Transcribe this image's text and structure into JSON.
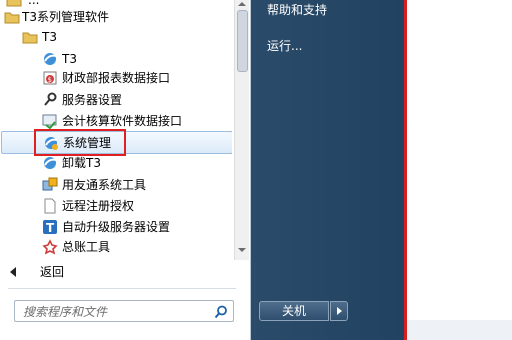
{
  "start_menu": {
    "program_items": [
      {
        "label": "...",
        "icon": "folder-icon"
      },
      {
        "label": "T3系列管理软件",
        "icon": "folder-icon"
      },
      {
        "label": "T3",
        "icon": "folder-icon"
      },
      {
        "label": "T3",
        "icon": "t3-app-icon"
      },
      {
        "label": "财政部报表数据接口",
        "icon": "report-interface-icon"
      },
      {
        "label": "服务器设置",
        "icon": "key-wrench-icon"
      },
      {
        "label": "会计核算软件数据接口",
        "icon": "accounting-interface-icon"
      },
      {
        "label": "系统管理",
        "icon": "system-management-icon"
      },
      {
        "label": "卸载T3",
        "icon": "uninstall-icon"
      },
      {
        "label": "用友通系统工具",
        "icon": "tools-icon"
      },
      {
        "label": "远程注册授权",
        "icon": "document-icon"
      },
      {
        "label": "自动升级服务器设置",
        "icon": "t-logo-icon"
      },
      {
        "label": "总账工具",
        "icon": "ledger-tool-icon"
      }
    ],
    "back_label": "返回",
    "search_placeholder": "搜索程序和文件"
  },
  "right_pane": {
    "help_label": "帮助和支持",
    "run_label": "运行...",
    "shutdown_label": "关机"
  },
  "colors": {
    "highlight": "#e02020",
    "right_pane_bg": "#214260"
  }
}
